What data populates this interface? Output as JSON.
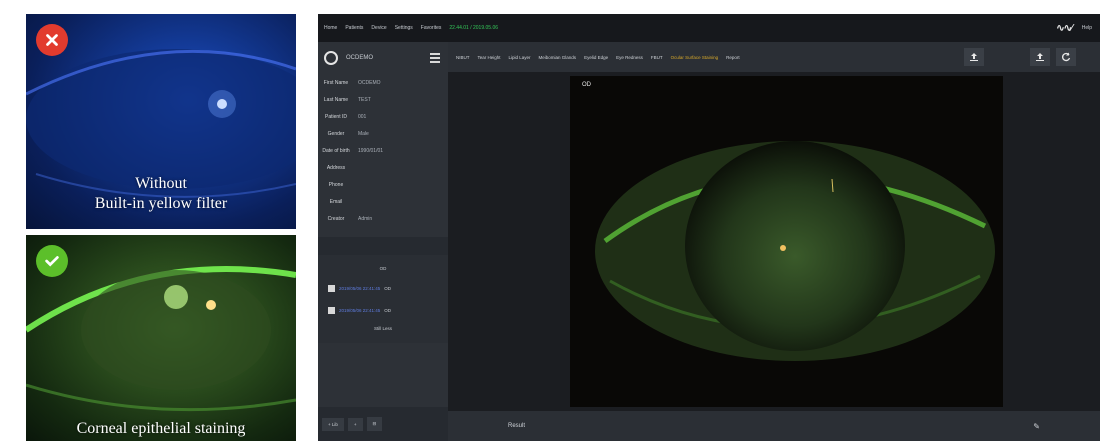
{
  "left_panel": {
    "top_caption_line1": "Without",
    "top_caption_line2": "Built-in yellow filter",
    "bottom_caption": "Corneal epithelial staining"
  },
  "app": {
    "nav": {
      "home": "Home",
      "patients": "Patients",
      "device": "Device",
      "settings": "Settings",
      "favorites": "Favorites",
      "status": "22.44.01 / 2019.05.06",
      "help": "Help"
    },
    "sidebar": {
      "user_name": "OCDEMO",
      "fields": [
        {
          "label": "First Name",
          "value": "OCDEMO"
        },
        {
          "label": "Last Name",
          "value": "TEST"
        },
        {
          "label": "Patient ID",
          "value": "001"
        },
        {
          "label": "Gender",
          "value": "Male"
        },
        {
          "label": "Date of birth",
          "value": "1990/01/01"
        },
        {
          "label": "Address",
          "value": ""
        },
        {
          "label": "Phone",
          "value": ""
        },
        {
          "label": "Email",
          "value": ""
        },
        {
          "label": "Creator",
          "value": "Admin"
        }
      ],
      "visit_group_label": "OD",
      "visits": [
        {
          "date": "2019/05/06 22:41:45",
          "eye": "OD"
        },
        {
          "date": "2019/05/06 22:41:45",
          "eye": "OD"
        }
      ],
      "view_more": "Still Less",
      "bottom_buttons": [
        "+ Lib",
        "+",
        "⊟"
      ]
    },
    "tabs": [
      "NIBUT",
      "Tear Height",
      "Lipid Layer",
      "Meibomian Glands",
      "Eyelid Edge",
      "Eye Redness",
      "FBUT",
      "Ocular Surface Staining",
      "Report"
    ],
    "active_tab_index": 7,
    "viewer": {
      "eye_label": "OD"
    },
    "result_label": "Result"
  }
}
